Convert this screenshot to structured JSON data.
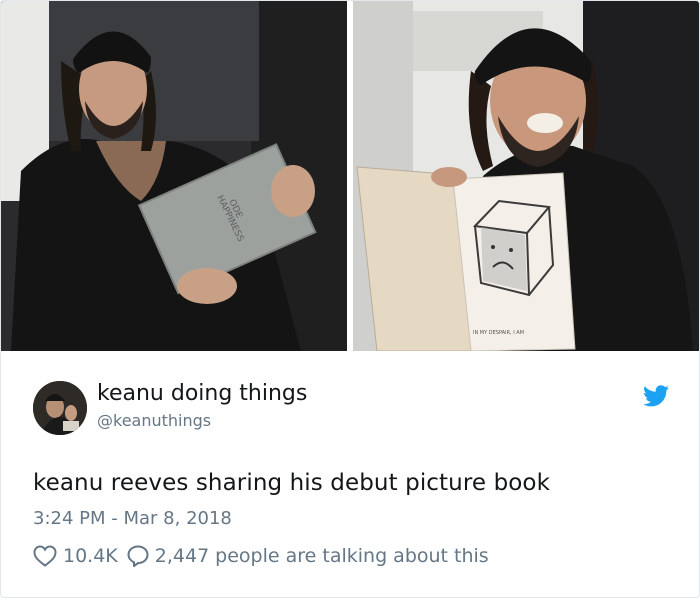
{
  "author": {
    "display_name": "keanu doing things",
    "handle": "@keanuthings"
  },
  "tweet": {
    "text": "keanu reeves sharing his debut picture book",
    "time": "3:24 PM",
    "separator": "-",
    "date": "Mar 8, 2018"
  },
  "engagement": {
    "likes": "10.4K",
    "replies": "2,447",
    "talking_label": "people are talking about this"
  },
  "media": {
    "book_title_line1": "ODE",
    "book_title_line2": "TO",
    "book_title_line3": "HAPPINESS",
    "page_caption": "IN MY DESPAIR, I AM"
  },
  "icons": {
    "brand": "twitter-bird-icon",
    "like": "heart-icon",
    "reply": "speech-bubble-icon"
  },
  "colors": {
    "brand_blue": "#1da1f2",
    "secondary_text": "#657786",
    "primary_text": "#14171a"
  }
}
